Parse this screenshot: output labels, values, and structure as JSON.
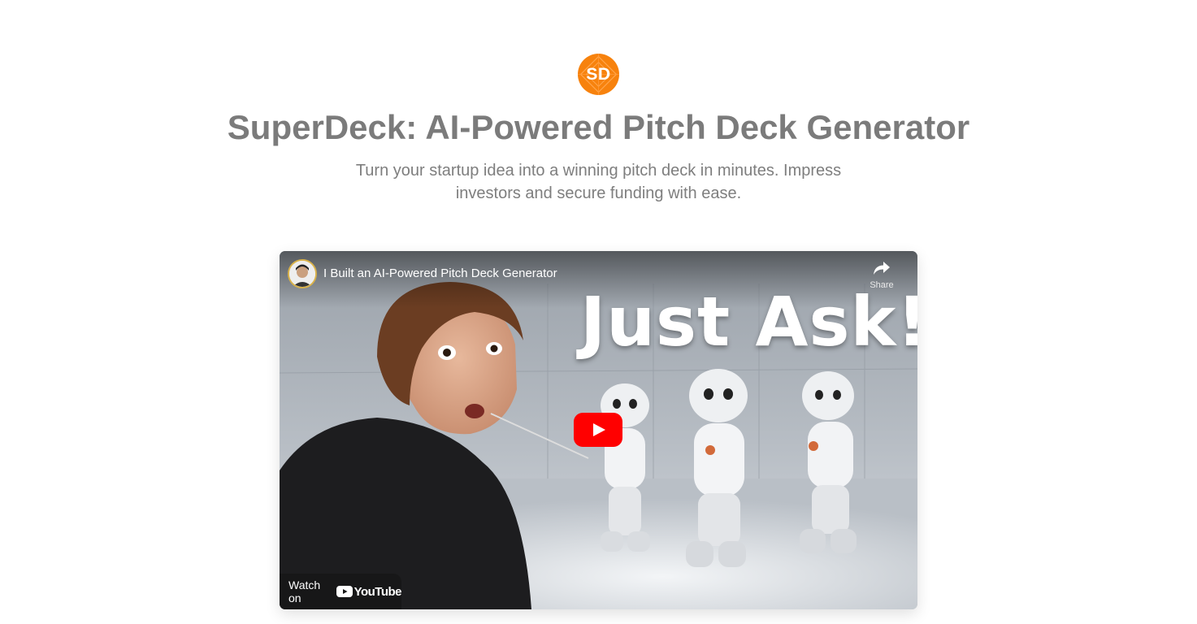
{
  "logo": {
    "text": "SD",
    "color": "#f7820d",
    "icon": "sd-logo-icon"
  },
  "hero": {
    "title": "SuperDeck: AI-Powered Pitch Deck Generator",
    "subtitle": "Turn your startup idea into a winning pitch deck in minutes. Impress investors and secure funding with ease."
  },
  "video": {
    "title": "I Built an AI-Powered Pitch Deck Generator",
    "share_label": "Share",
    "thumbnail_text": "Just Ask!",
    "watch_label": "Watch on",
    "platform_name": "YouTube",
    "play_color": "#ff0000",
    "icons": {
      "share": "share-arrow-icon",
      "play": "play-icon",
      "platform": "youtube-logo-icon",
      "avatar": "channel-avatar"
    }
  }
}
